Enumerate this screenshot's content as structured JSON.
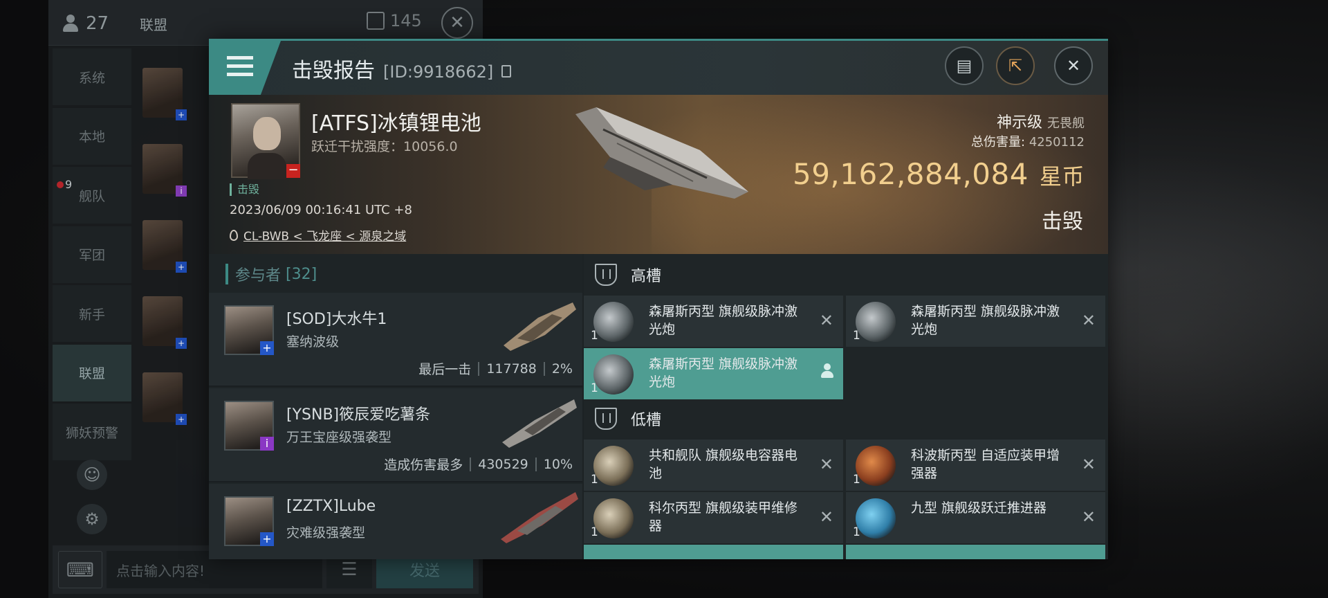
{
  "chat": {
    "online_count": "27",
    "title": "联盟",
    "message_count": "145",
    "nav": [
      {
        "label": "系统"
      },
      {
        "label": "本地"
      },
      {
        "label": "舰队",
        "badge": "9"
      },
      {
        "label": "军团"
      },
      {
        "label": "新手"
      },
      {
        "label": "联盟",
        "active": true
      },
      {
        "label": "狮妖预警"
      }
    ],
    "input_placeholder": "点击输入内容!",
    "send_label": "发送"
  },
  "report": {
    "title": "击毁报告",
    "id_text": "[ID:9918662]",
    "victim": {
      "name": "[ATFS]冰镇锂电池",
      "warp_label": "跃迁干扰强度：",
      "warp_value": "10056.0",
      "kill_tag": "击毁",
      "time": "2023/06/09 00:16:41 UTC +8",
      "location": "CL-BWB < 飞龙座 < 源泉之域"
    },
    "ship_class": "神示级",
    "ship_type": "无畏舰",
    "total_damage_label": "总伤害量:",
    "total_damage": "4250112",
    "value": "59,162,884,084",
    "currency": "星币",
    "result": "击毁"
  },
  "participants": {
    "label": "参与者",
    "count": "[32]",
    "rows": [
      {
        "name": "[SOD]大水牛1",
        "ship": "塞纳波级",
        "note": "最后一击",
        "damage": "117788",
        "percent": "2%",
        "tag": "+",
        "tag_color": "#2457c7"
      },
      {
        "name": "[YSNB]筱辰爱吃薯条",
        "ship": "万王宝座级强袭型",
        "note": "造成伤害最多",
        "damage": "430529",
        "percent": "10%",
        "tag": "i",
        "tag_color": "#8a38c4"
      },
      {
        "name": "[ZZTX]Lube",
        "ship": "灾难级强袭型",
        "note": "",
        "damage": "",
        "percent": "",
        "tag": "+",
        "tag_color": "#2457c7"
      }
    ]
  },
  "fitting": {
    "high_label": "高槽",
    "low_label": "低槽",
    "high": [
      {
        "name": "森屠斯丙型 旗舰级脉冲激光炮",
        "qty": "1",
        "icon": "laser-icon"
      },
      {
        "name": "森屠斯丙型 旗舰级脉冲激光炮",
        "qty": "1",
        "icon": "laser-icon"
      },
      {
        "name": "森屠斯丙型 旗舰级脉冲激光炮",
        "qty": "1",
        "icon": "laser-icon",
        "active": true
      }
    ],
    "low": [
      {
        "name": "共和舰队 旗舰级电容器电池",
        "qty": "1",
        "icon": "capacitor-icon"
      },
      {
        "name": "科波斯丙型 自适应装甲增强器",
        "qty": "1",
        "icon": "armor-hardener-icon"
      },
      {
        "name": "科尔丙型 旗舰级装甲维修器",
        "qty": "1",
        "icon": "armor-repairer-icon"
      },
      {
        "name": "九型 旗舰级跃迁推进器",
        "qty": "1",
        "icon": "warp-core-icon"
      }
    ]
  },
  "colors": {
    "accent": "#3c8a84",
    "isk_gold": "#f2cf8e",
    "active_module": "#4f9d92"
  }
}
